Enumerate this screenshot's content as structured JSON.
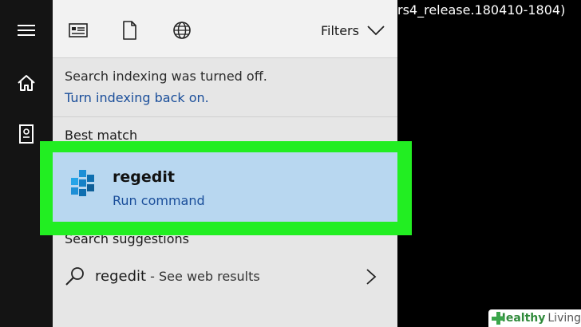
{
  "console": {
    "text": "rs4_release.180410-1804)"
  },
  "rail": {
    "icons": [
      "hamburger-menu-icon",
      "home-icon",
      "notebook-icon"
    ]
  },
  "topbar": {
    "icons": [
      "apps-icon",
      "documents-icon",
      "web-globe-icon"
    ],
    "filters_label": "Filters"
  },
  "notice": {
    "message": "Search indexing was turned off.",
    "link": "Turn indexing back on."
  },
  "best_match": {
    "heading": "Best match",
    "title": "regedit",
    "subtitle": "Run command",
    "icon": "regedit-cubes-icon"
  },
  "suggestions": {
    "heading": "Search suggestions",
    "query": "regedit",
    "hint": " - See web results"
  },
  "watermark": {
    "part1": "Healthy",
    "part2": "Living"
  },
  "colors": {
    "highlight": "#22ee22",
    "selected_bg": "#b8d7f0",
    "link": "#1a4e9a",
    "panel_bg": "#e6e6e6"
  }
}
